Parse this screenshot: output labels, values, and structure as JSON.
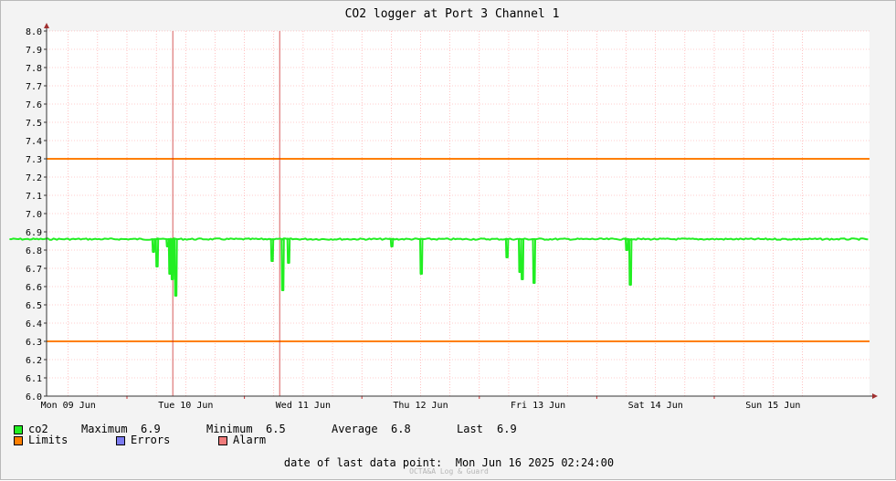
{
  "chart_data": {
    "type": "line",
    "title": "CO2 logger at Port 3 Channel 1",
    "xlabel": "",
    "ylabel": "",
    "ylim": [
      6.0,
      8.0
    ],
    "yticks": [
      6.0,
      6.1,
      6.2,
      6.3,
      6.4,
      6.5,
      6.6,
      6.7,
      6.8,
      6.9,
      7.0,
      7.1,
      7.2,
      7.3,
      7.4,
      7.5,
      7.6,
      7.7,
      7.8,
      7.9,
      8.0
    ],
    "xlim_days": [
      0,
      7.0
    ],
    "x_day_labels": [
      "Mon 09 Jun",
      "Tue 10 Jun",
      "Wed 11 Jun",
      "Thu 12 Jun",
      "Fri 13 Jun",
      "Sat 14 Jun",
      "Sun 15 Jun"
    ],
    "grid": true,
    "limits": [
      7.3,
      6.3
    ],
    "series": [
      {
        "name": "co2",
        "color": "#22ee22",
        "baseline": 6.86,
        "dips": [
          {
            "day": 1.22,
            "value": 6.79
          },
          {
            "day": 1.25,
            "value": 6.71
          },
          {
            "day": 1.34,
            "value": 6.82
          },
          {
            "day": 1.36,
            "value": 6.67
          },
          {
            "day": 1.37,
            "value": 6.74
          },
          {
            "day": 1.38,
            "value": 6.64
          },
          {
            "day": 1.41,
            "value": 6.55
          },
          {
            "day": 2.23,
            "value": 6.74
          },
          {
            "day": 2.32,
            "value": 6.58
          },
          {
            "day": 2.37,
            "value": 6.73
          },
          {
            "day": 3.25,
            "value": 6.82
          },
          {
            "day": 3.5,
            "value": 6.67
          },
          {
            "day": 4.23,
            "value": 6.76
          },
          {
            "day": 4.34,
            "value": 6.68
          },
          {
            "day": 4.36,
            "value": 6.64
          },
          {
            "day": 4.46,
            "value": 6.62
          },
          {
            "day": 5.25,
            "value": 6.8
          },
          {
            "day": 5.28,
            "value": 6.61
          }
        ]
      }
    ],
    "event_markers_days": [
      1.39,
      2.3
    ]
  },
  "legend": {
    "series_name": "co2",
    "maximum_label": "Maximum",
    "maximum_value": "6.9",
    "minimum_label": "Minimum",
    "minimum_value": "6.5",
    "average_label": "Average",
    "average_value": "6.8",
    "last_label": "Last",
    "last_value": "6.9",
    "limits_label": "Limits",
    "errors_label": "Errors",
    "alarm_label": "Alarm"
  },
  "footer": {
    "date_label": "date of last data point:",
    "date_value": "Mon Jun 16 2025 02:24:00",
    "watermark": "OCTA&A Log & Guard"
  },
  "colors": {
    "co2": "#22ee22",
    "limits": "#ff7f00",
    "errors": "#7b7bef",
    "alarm": "#ef7b7b",
    "grid": "#ff9999",
    "marker": "#cc3333"
  }
}
